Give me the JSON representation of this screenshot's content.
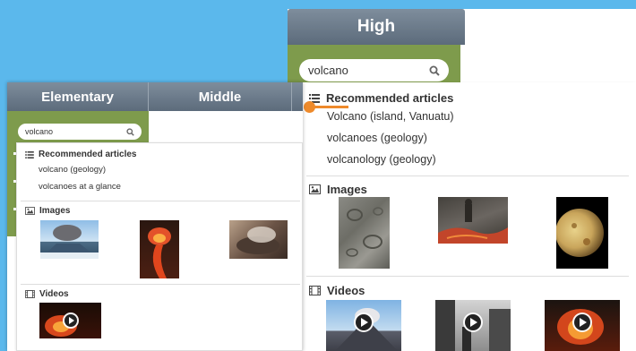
{
  "high": {
    "tab_label": "High",
    "search_value": "volcano",
    "recommended_title": "Recommended articles",
    "articles": [
      "Volcano (island, Vanuatu)",
      "volcanoes (geology)",
      "volcanology (geology)"
    ],
    "images_title": "Images",
    "videos_title": "Videos"
  },
  "elementary": {
    "tabs": [
      "Elementary",
      "Middle"
    ],
    "search_value": "volcano",
    "recommended_title": "Recommended articles",
    "articles": [
      "volcano (geology)",
      "volcanoes at a glance"
    ],
    "images_title": "Images",
    "videos_title": "Videos"
  },
  "colors": {
    "tab": "#6c7b8b",
    "green": "#7e9b4c",
    "accent_orange": "#ee8a2b",
    "background": "#5bb8ec"
  },
  "icons": [
    "search-icon",
    "list-icon",
    "image-icon",
    "film-icon",
    "play-icon"
  ]
}
